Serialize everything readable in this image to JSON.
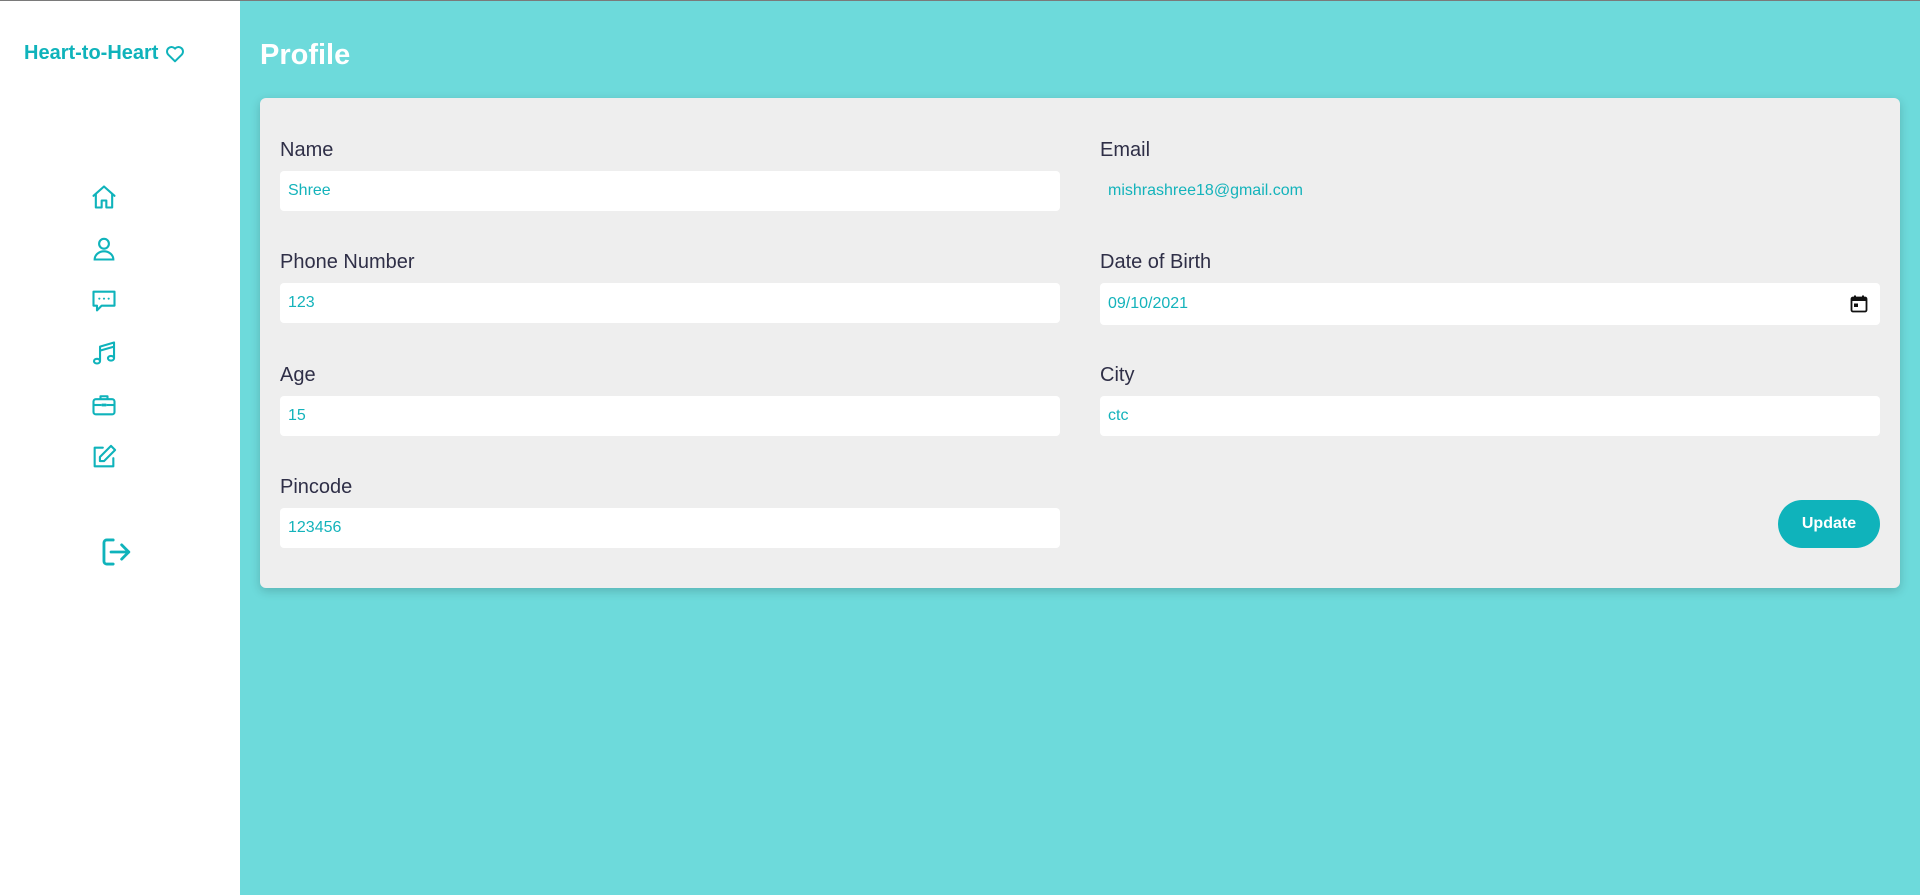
{
  "brand": {
    "name": "Heart-to-Heart",
    "icon": "heart-icon"
  },
  "colors": {
    "accent": "#0fb3bb",
    "background": "#6ddadb",
    "card": "#eeeeee",
    "label": "#2f2f47"
  },
  "nav": {
    "items": [
      {
        "icon": "home-icon"
      },
      {
        "icon": "user-icon"
      },
      {
        "icon": "chat-icon"
      },
      {
        "icon": "music-icon"
      },
      {
        "icon": "briefcase-icon"
      },
      {
        "icon": "edit-icon"
      }
    ],
    "logout_icon": "logout-icon"
  },
  "page": {
    "title": "Profile"
  },
  "form": {
    "name": {
      "label": "Name",
      "value": "Shree"
    },
    "email": {
      "label": "Email",
      "value": "mishrashree18@gmail.com"
    },
    "phone": {
      "label": "Phone Number",
      "value": "123"
    },
    "dob": {
      "label": "Date of Birth",
      "value": "09/10/2021"
    },
    "age": {
      "label": "Age",
      "value": "15"
    },
    "city": {
      "label": "City",
      "value": "ctc"
    },
    "pincode": {
      "label": "Pincode",
      "value": "123456"
    },
    "update_label": "Update"
  }
}
